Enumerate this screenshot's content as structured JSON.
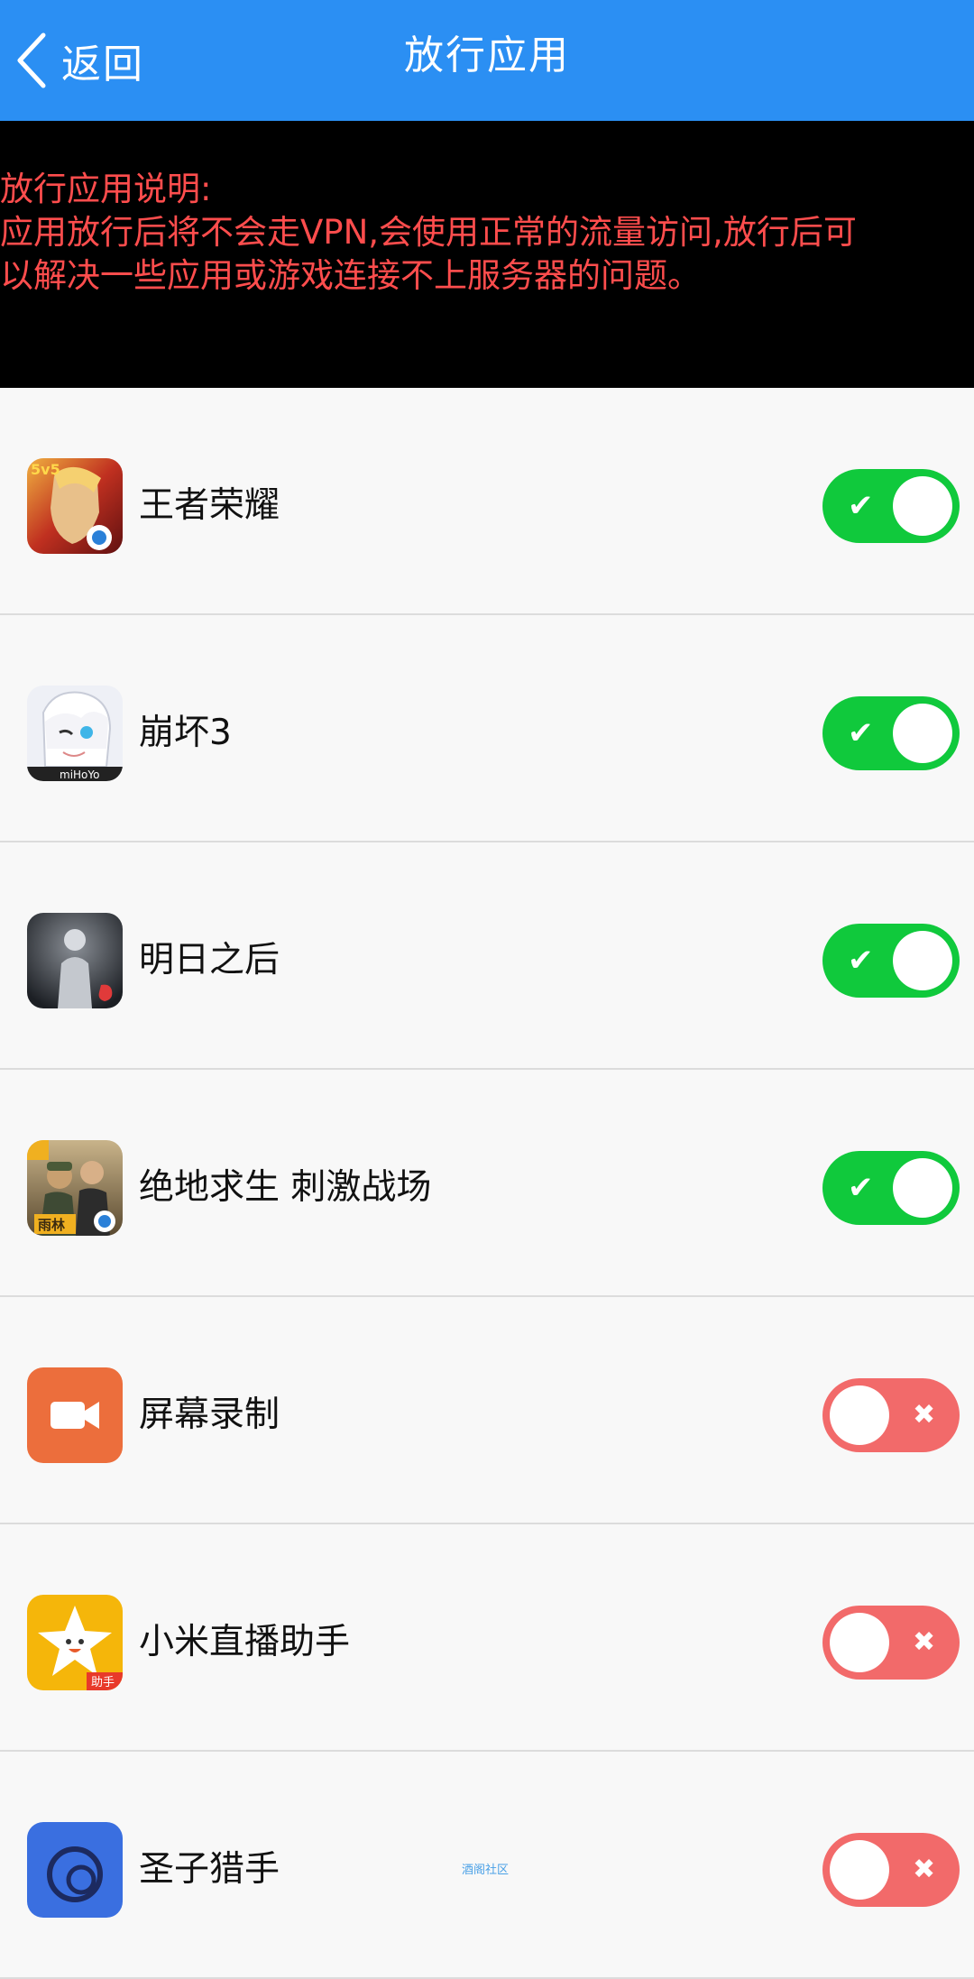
{
  "header": {
    "back_label": "返回",
    "title": "放行应用",
    "background": "#2b8ff3"
  },
  "notice": {
    "lines": [
      "放行应用说明:",
      "应用放行后将不会走VPN,会使用正常的流量访问,放行后可",
      "以解决一些应用或游戏连接不上服务器的问题。"
    ],
    "text_color": "#ff4d4d"
  },
  "apps": [
    {
      "name": "王者荣耀",
      "enabled": true,
      "icon": "honor-of-kings-icon",
      "badge_text": "5v5"
    },
    {
      "name": "崩坏3",
      "enabled": true,
      "icon": "honkai-impact-icon",
      "badge_text": "miHoYo"
    },
    {
      "name": "明日之后",
      "enabled": true,
      "icon": "lifeafter-icon"
    },
    {
      "name": "绝地求生 刺激战场",
      "enabled": true,
      "icon": "pubg-mobile-icon",
      "badge_text": "雨林"
    },
    {
      "name": "屏幕录制",
      "enabled": false,
      "icon": "screen-recorder-icon"
    },
    {
      "name": "小米直播助手",
      "enabled": false,
      "icon": "xiaomi-live-icon",
      "badge_text": "助手"
    },
    {
      "name": "圣子猎手",
      "enabled": false,
      "icon": "app-icon"
    }
  ],
  "toggle": {
    "on_mark": "✔",
    "off_mark": "✖",
    "on_color": "#10c93c",
    "off_color": "#f26a6a"
  },
  "watermark": "酒阁社区"
}
